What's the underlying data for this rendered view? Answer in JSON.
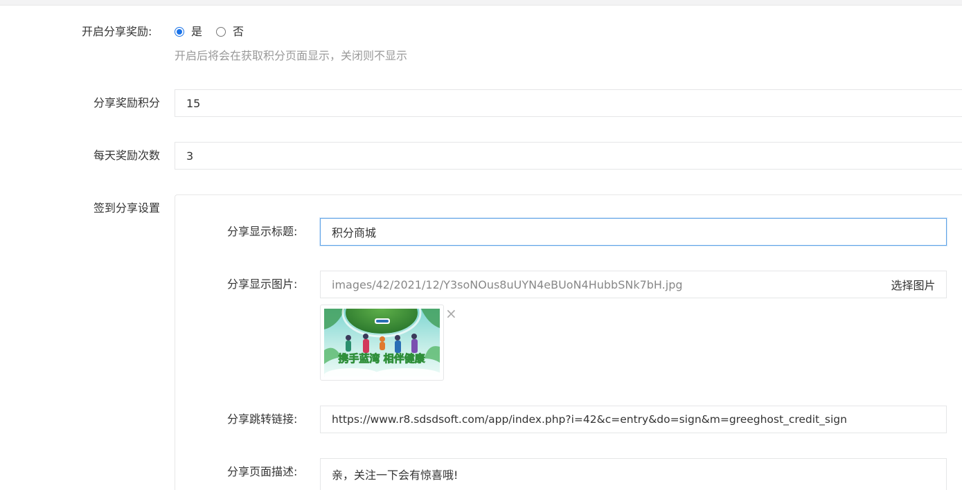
{
  "form": {
    "enable_share_reward": {
      "label": "开启分享奖励:",
      "options": [
        "是",
        "否"
      ],
      "selected": "是",
      "help": "开启后将会在获取积分页面显示，关闭则不显示"
    },
    "reward_points": {
      "label": "分享奖励积分",
      "value": "15"
    },
    "daily_reward_times": {
      "label": "每天奖励次数",
      "value": "3"
    },
    "signin_share_settings": {
      "label": "签到分享设置",
      "share_title": {
        "label": "分享显示标题:",
        "value": "积分商城"
      },
      "share_image": {
        "label": "分享显示图片:",
        "value": "images/42/2021/12/Y3soNOus8uUYN4eBUoN4HubbSNk7bH.jpg",
        "choose_label": "选择图片",
        "thumbnail_caption": "携手蓝湾 相伴健康",
        "remove_symbol": "×"
      },
      "share_link": {
        "label": "分享跳转链接:",
        "value": "https://www.r8.sdsdsoft.com/app/index.php?i=42&c=entry&do=sign&m=greeghost_credit_sign"
      },
      "share_description": {
        "label": "分享页面描述:",
        "value": "亲，关注一下会有惊喜哦!"
      }
    }
  },
  "colors": {
    "accent": "#1a73e8",
    "focus_border": "#5ea3e6",
    "help_text": "#999999",
    "border": "#e5e6e7",
    "caption_yellow": "#f5e100",
    "caption_green": "#2f8f3a"
  }
}
